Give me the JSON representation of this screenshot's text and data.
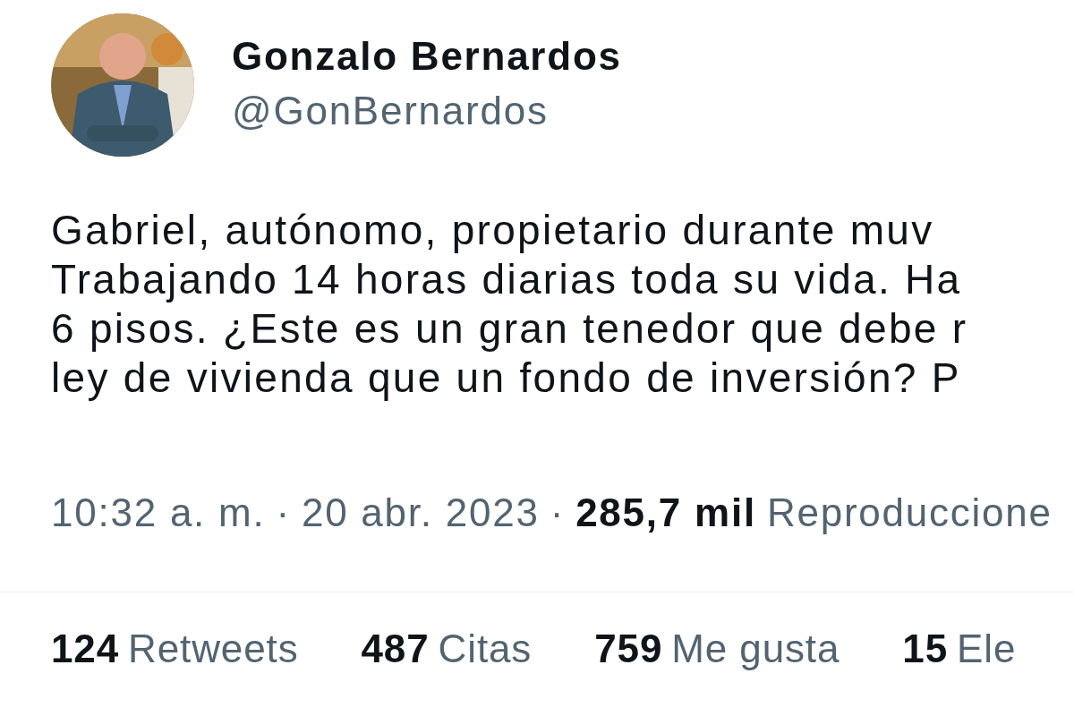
{
  "author": {
    "name": "Gonzalo Bernardos",
    "handle": "@GonBernardos"
  },
  "tweet": {
    "lines": [
      "Gabriel, autónomo, propietario durante muv",
      "Trabajando 14 horas diarias toda su vida. Ha",
      "6 pisos. ¿Este es un gran tenedor que debe r",
      "ley de vivienda que un fondo de inversión? P"
    ]
  },
  "meta": {
    "time": "10:32 a. m.",
    "separator": "·",
    "date": "20 abr. 2023",
    "views_count": "285,7 mil",
    "views_label": "Reproduccione"
  },
  "stats": [
    {
      "count": "124",
      "label": "Retweets"
    },
    {
      "count": "487",
      "label": "Citas"
    },
    {
      "count": "759",
      "label": "Me gusta"
    },
    {
      "count": "15",
      "label": "Ele"
    }
  ]
}
